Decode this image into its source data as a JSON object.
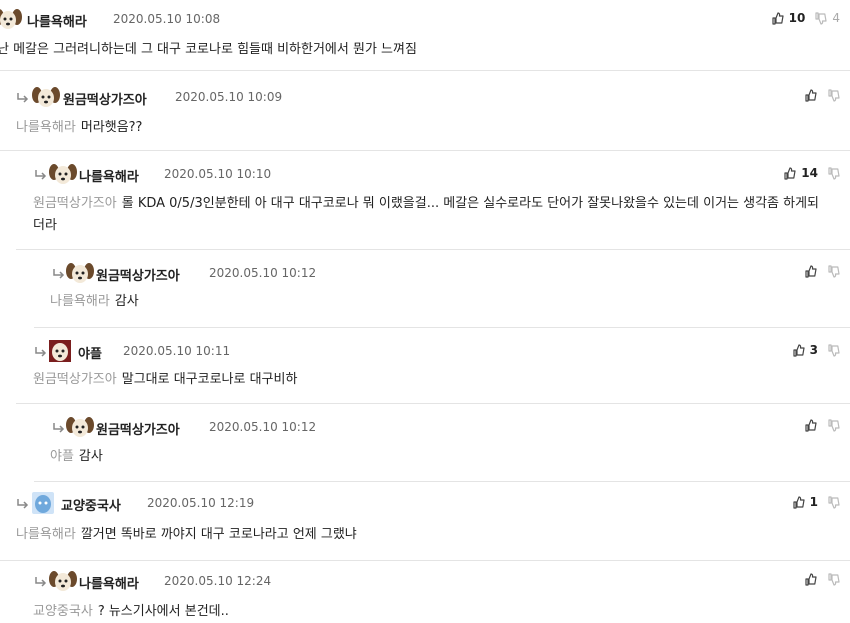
{
  "comments": [
    {
      "author": "나를욕해라",
      "date": "2020.05.10 10:08",
      "mention": "",
      "text": "난 메갈은 그러려니하는데 그 대구 코로나로 힘들때 비하한거에서 뭔가 느껴짐",
      "up": "10",
      "down": "4",
      "avatar": "puppy-avatar"
    },
    {
      "author": "원금떡상가즈아",
      "date": "2020.05.10 10:09",
      "mention": "나를욕해라",
      "text": "머라햇음??",
      "up": "",
      "down": "",
      "avatar": "puppy-avatar"
    },
    {
      "author": "나를욕해라",
      "date": "2020.05.10 10:10",
      "mention": "원금떡상가즈아",
      "text": "롤 KDA 0/5/3인분한테 아 대구 대구코로나 뭐 이랬을걸... 메갈은 실수로라도 단어가 잘못나왔을수 있는데 이거는 생각좀 하게되더라",
      "up": "14",
      "down": "",
      "avatar": "puppy-avatar"
    },
    {
      "author": "원금떡상가즈아",
      "date": "2020.05.10 10:12",
      "mention": "나를욕해라",
      "text": "감사",
      "up": "",
      "down": "",
      "avatar": "puppy-avatar"
    },
    {
      "author": "야플",
      "date": "2020.05.10 10:11",
      "mention": "원금떡상가즈아",
      "text": "말그대로 대구코로나로 대구비하",
      "up": "3",
      "down": "",
      "avatar": "puppy-red-avatar"
    },
    {
      "author": "원금떡상가즈아",
      "date": "2020.05.10 10:12",
      "mention": "야플",
      "text": "감사",
      "up": "",
      "down": "",
      "avatar": "puppy-avatar"
    },
    {
      "author": "교양중국사",
      "date": "2020.05.10 12:19",
      "mention": "나를욕해라",
      "text": "깔거면 똑바로 까야지 대구 코로나라고 언제 그랬냐",
      "up": "1",
      "down": "",
      "avatar": "blue-avatar"
    },
    {
      "author": "나를욕해라",
      "date": "2020.05.10 12:24",
      "mention": "교양중국사",
      "text": "? 뉴스기사에서 본건데..",
      "up": "",
      "down": "",
      "avatar": "puppy-avatar"
    }
  ],
  "colors": {
    "border": "#e4e4e4",
    "mention": "#999999",
    "date": "#666666",
    "down_count": "#aaaaaa"
  }
}
